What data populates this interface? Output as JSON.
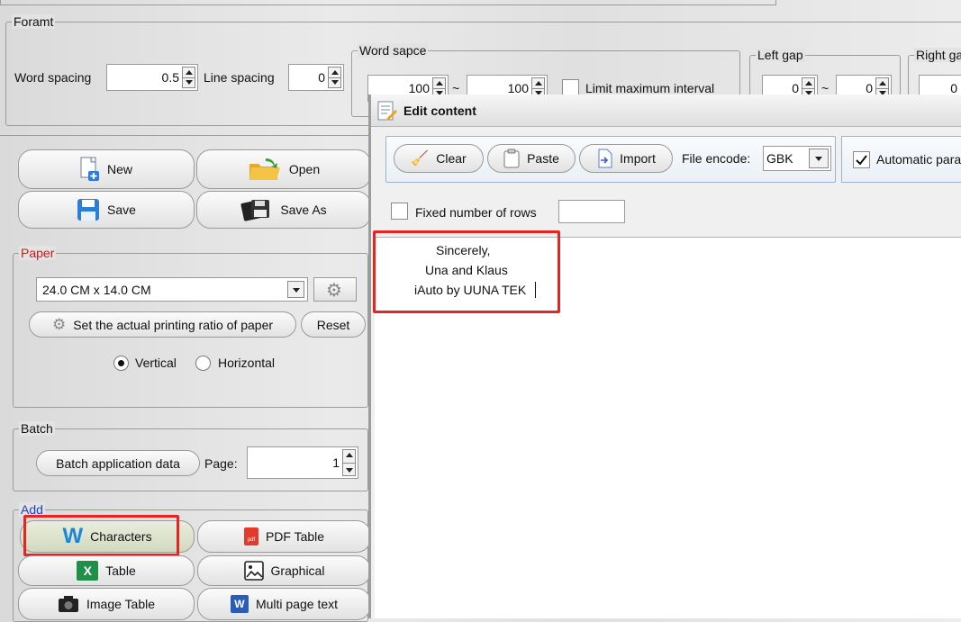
{
  "format": {
    "title": "Foramt",
    "word_spacing_label": "Word spacing",
    "word_spacing_value": "0.5",
    "line_spacing_label": "Line spacing",
    "line_spacing_value": "0",
    "word_space_group": {
      "title": "Word sapce",
      "min": "100",
      "tilde": "~",
      "max": "100",
      "limit_label": "Limit maximum interval"
    },
    "left_gap": {
      "title": "Left gap",
      "a": "0",
      "tilde": "~",
      "b": "0"
    },
    "right_gap": {
      "title": "Right ga",
      "a": "0"
    }
  },
  "file_buttons": {
    "new": "New",
    "open": "Open",
    "save": "Save",
    "save_as": "Save As"
  },
  "paper": {
    "title": "Paper",
    "size": "24.0 CM x 14.0 CM",
    "ratio_button": "Set the actual printing ratio of paper",
    "reset_button": "Reset",
    "vertical": "Vertical",
    "horizontal": "Horizontal"
  },
  "batch": {
    "title": "Batch",
    "apply_button": "Batch application data",
    "page_label": "Page:",
    "page_value": "1"
  },
  "add": {
    "title": "Add",
    "characters": "Characters",
    "pdf_table": "PDF Table",
    "table": "Table",
    "graphical": "Graphical",
    "image_table": "Image Table",
    "multi_page_text": "Multi page text"
  },
  "edit_window": {
    "title": "Edit content",
    "clear": "Clear",
    "paste": "Paste",
    "import": "Import",
    "encode_label": "File encode:",
    "encode_value": "GBK",
    "auto_para": "Automatic para",
    "fixed_rows_label": "Fixed number of rows",
    "content_lines": [
      "Sincerely,",
      "Una and Klaus",
      "iAuto by UUNA TEK"
    ]
  },
  "colors": {
    "highlight": "#e52620",
    "paper_title": "#d11",
    "add_title": "#1a3fd0"
  }
}
